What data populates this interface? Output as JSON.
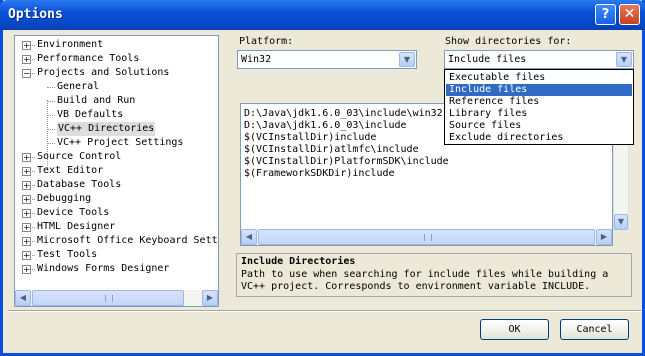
{
  "window": {
    "title": "Options",
    "help_label": "?",
    "close_label": "✕"
  },
  "tree": {
    "items": [
      {
        "label": "Environment",
        "expander": "+"
      },
      {
        "label": "Performance Tools",
        "expander": "+"
      },
      {
        "label": "Projects and Solutions",
        "expander": "−"
      },
      {
        "label": "General"
      },
      {
        "label": "Build and Run"
      },
      {
        "label": "VB Defaults"
      },
      {
        "label": "VC++ Directories"
      },
      {
        "label": "VC++ Project Settings"
      },
      {
        "label": "Source Control",
        "expander": "+"
      },
      {
        "label": "Text Editor",
        "expander": "+"
      },
      {
        "label": "Database Tools",
        "expander": "+"
      },
      {
        "label": "Debugging",
        "expander": "+"
      },
      {
        "label": "Device Tools",
        "expander": "+"
      },
      {
        "label": "HTML Designer",
        "expander": "+"
      },
      {
        "label": "Microsoft Office Keyboard Sett",
        "expander": "+"
      },
      {
        "label": "Test Tools",
        "expander": "+"
      },
      {
        "label": "Windows Forms Designer",
        "expander": "+"
      }
    ],
    "selected": "VC++ Directories"
  },
  "platform": {
    "label": "Platform:",
    "value": "Win32"
  },
  "show_dirs": {
    "label": "Show directories for:",
    "value": "Include files",
    "options": [
      "Executable files",
      "Include files",
      "Reference files",
      "Library files",
      "Source files",
      "Exclude directories"
    ],
    "selected_option": "Include files"
  },
  "directories": [
    "D:\\Java\\jdk1.6.0_03\\include\\win32",
    "D:\\Java\\jdk1.6.0_03\\include",
    "$(VCInstallDir)include",
    "$(VCInstallDir)atlmfc\\include",
    "$(VCInstallDir)PlatformSDK\\include",
    "$(FrameworkSDKDir)include"
  ],
  "description": {
    "title": "Include Directories",
    "text": "Path to use when searching for include files while building a VC++ project.  Corresponds to environment variable INCLUDE."
  },
  "buttons": {
    "ok": "OK",
    "cancel": "Cancel"
  },
  "icons": {
    "arrow_left": "◀",
    "arrow_right": "▶",
    "arrow_up": "▲",
    "arrow_down": "▼",
    "dropdown": "▼"
  }
}
